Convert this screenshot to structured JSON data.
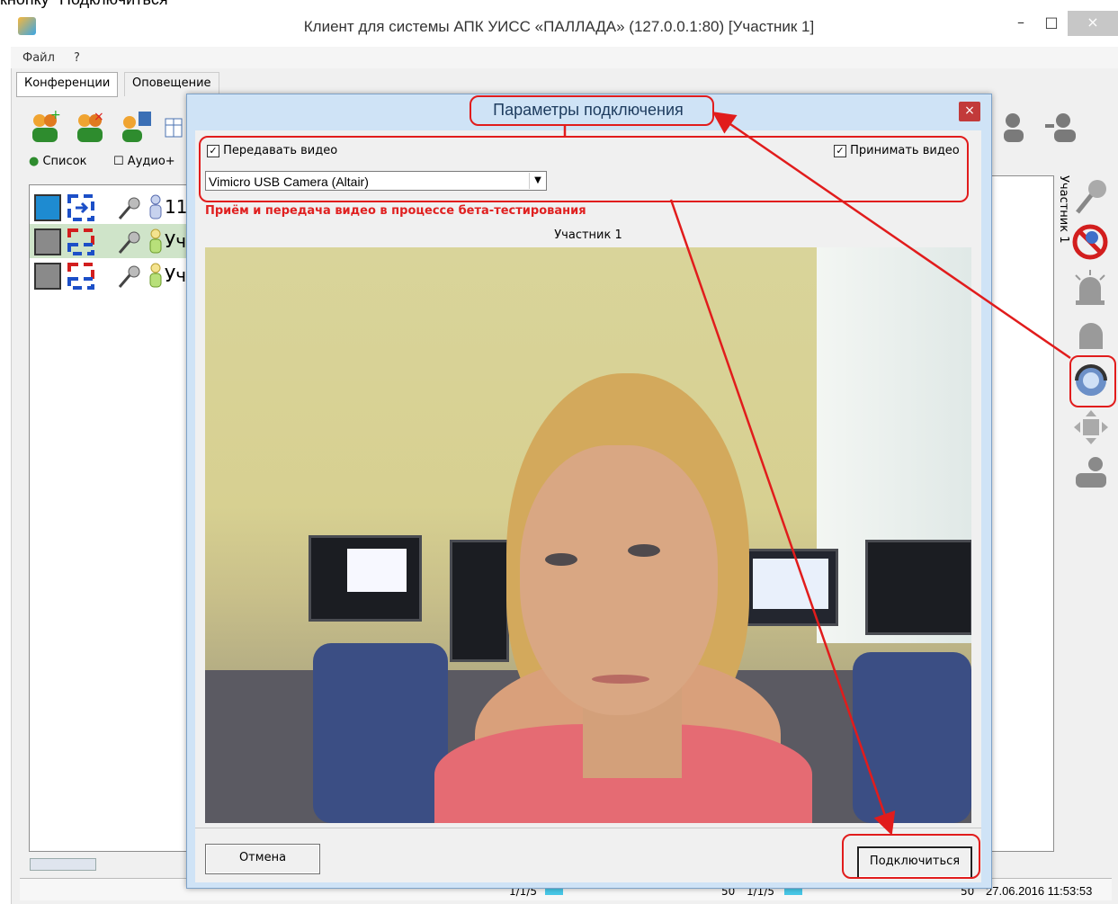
{
  "caption": "кнопку \"Подключиться\"",
  "window": {
    "title": "Клиент для системы АПК УИСС «ПАЛЛАДА» (127.0.0.1:80) [Участник 1]",
    "minimize": "–",
    "maximize": "□",
    "close": "×"
  },
  "menu": {
    "file": "Файл",
    "help": "?"
  },
  "tabs": [
    {
      "label": "Конференции"
    },
    {
      "label": "Оповещение"
    }
  ],
  "subtabs": {
    "list": "Список",
    "audio": "Аудио+"
  },
  "rows": [
    {
      "label": "11"
    },
    {
      "label": "Уч"
    },
    {
      "label": "Уч"
    }
  ],
  "right_panel": {
    "label": "Участник 1"
  },
  "status": {
    "page1": "1/1/5",
    "page2": "1/1/5",
    "num1": "50",
    "num2": "50",
    "time": "27.06.2016 11:53:53"
  },
  "dialog": {
    "title": "Параметры подключения",
    "close": "×",
    "send_video": {
      "label": "Передавать видео",
      "checked": true
    },
    "receive_video": {
      "label": "Принимать видео",
      "checked": true
    },
    "camera": {
      "value": "Vimicro USB Camera (Altair)"
    },
    "warning": "Приём и передача видео в процессе бета-тестирования",
    "participant": "Участник 1",
    "cancel": "Отмена",
    "connect": "Подключиться"
  },
  "colors": {
    "annotation": "#e11c1c",
    "dialog_frame": "#cfe3f6",
    "warning": "#e02020"
  }
}
